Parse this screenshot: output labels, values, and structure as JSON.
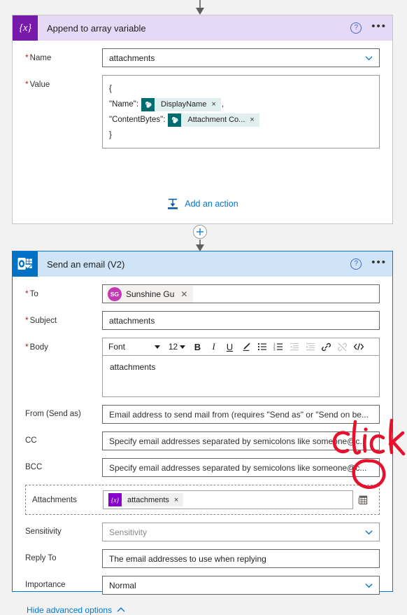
{
  "flow": {
    "append_card": {
      "icon": "variable-braces-icon",
      "title": "Append to array variable",
      "help_icon": "help-circle-icon",
      "menu_icon": "ellipsis-menu-icon",
      "fields": {
        "name_label": "Name",
        "name_value": "attachments",
        "value_label": "Value",
        "value_lines": [
          {
            "text": "{",
            "tokens": []
          },
          {
            "text": "\"Name\":",
            "tokens": [
              {
                "icon": "sharepoint-icon",
                "label": "DisplayName",
                "remove": "×"
              }
            ],
            "suffix": ","
          },
          {
            "text": "\"ContentBytes\":",
            "tokens": [
              {
                "icon": "sharepoint-icon",
                "label": "Attachment Co...",
                "remove": "×"
              }
            ],
            "suffix": ""
          },
          {
            "text": "}",
            "tokens": []
          }
        ]
      },
      "add_action_label": "Add an action",
      "add_action_icon": "insert-action-icon"
    },
    "connector": {
      "plus_icon": "add-step-plus-icon",
      "arrow_icon": "down-arrow-icon"
    },
    "email_card": {
      "icon": "outlook-icon",
      "title": "Send an email (V2)",
      "help_icon": "help-circle-icon",
      "menu_icon": "ellipsis-menu-icon",
      "to": {
        "label": "To",
        "person": {
          "initials": "SG",
          "name": "Sunshine Gu",
          "remove": "✕",
          "avatar_color": "#c239b3"
        }
      },
      "subject": {
        "label": "Subject",
        "value": "attachments"
      },
      "body": {
        "label": "Body",
        "toolbar": {
          "font_label": "Font",
          "size_label": "12",
          "bold": "B",
          "italic": "I",
          "underline": "U",
          "highlight_icon": "highlighter-pen-icon",
          "bullet_list_icon": "bulleted-list-icon",
          "number_list_icon": "numbered-list-icon",
          "outdent_icon": "decrease-indent-icon",
          "indent_icon": "increase-indent-icon",
          "link_icon": "insert-link-icon",
          "unlink_icon": "remove-link-icon",
          "code_icon": "code-view-icon"
        },
        "content": "attachments"
      },
      "from": {
        "label": "From (Send as)",
        "placeholder": "Email address to send mail from (requires \"Send as\" or \"Send on be..."
      },
      "cc": {
        "label": "CC",
        "placeholder": "Specify email addresses separated by semicolons like someone@c..."
      },
      "bcc": {
        "label": "BCC",
        "placeholder": "Specify email addresses separated by semicolons like someone@c..."
      },
      "attachments": {
        "label": "Attachments",
        "token": {
          "icon": "variable-braces-icon",
          "label": "attachments",
          "remove": "×"
        },
        "add_item_icon": "add-new-item-icon"
      },
      "sensitivity": {
        "label": "Sensitivity",
        "placeholder": "Sensitivity",
        "chevron_icon": "chevron-down-icon"
      },
      "reply_to": {
        "label": "Reply To",
        "placeholder": "The email addresses to use when replying"
      },
      "importance": {
        "label": "Importance",
        "value": "Normal",
        "chevron_icon": "chevron-down-icon"
      },
      "hide_advanced": {
        "label": "Hide advanced options",
        "chevron_icon": "chevron-up-icon"
      }
    }
  },
  "annotation": {
    "text": "click",
    "color": "#e8112d",
    "shape": "circle-highlight"
  },
  "colors": {
    "append_header": "#e6d9f7",
    "append_icon": "#7719aa",
    "email_header": "#cfe4f7",
    "email_icon": "#0072c6",
    "accent_link": "#0078d4",
    "required_star": "#a4262c",
    "sharepoint_token": "#036c70",
    "page_background": "#f2f2f2"
  }
}
